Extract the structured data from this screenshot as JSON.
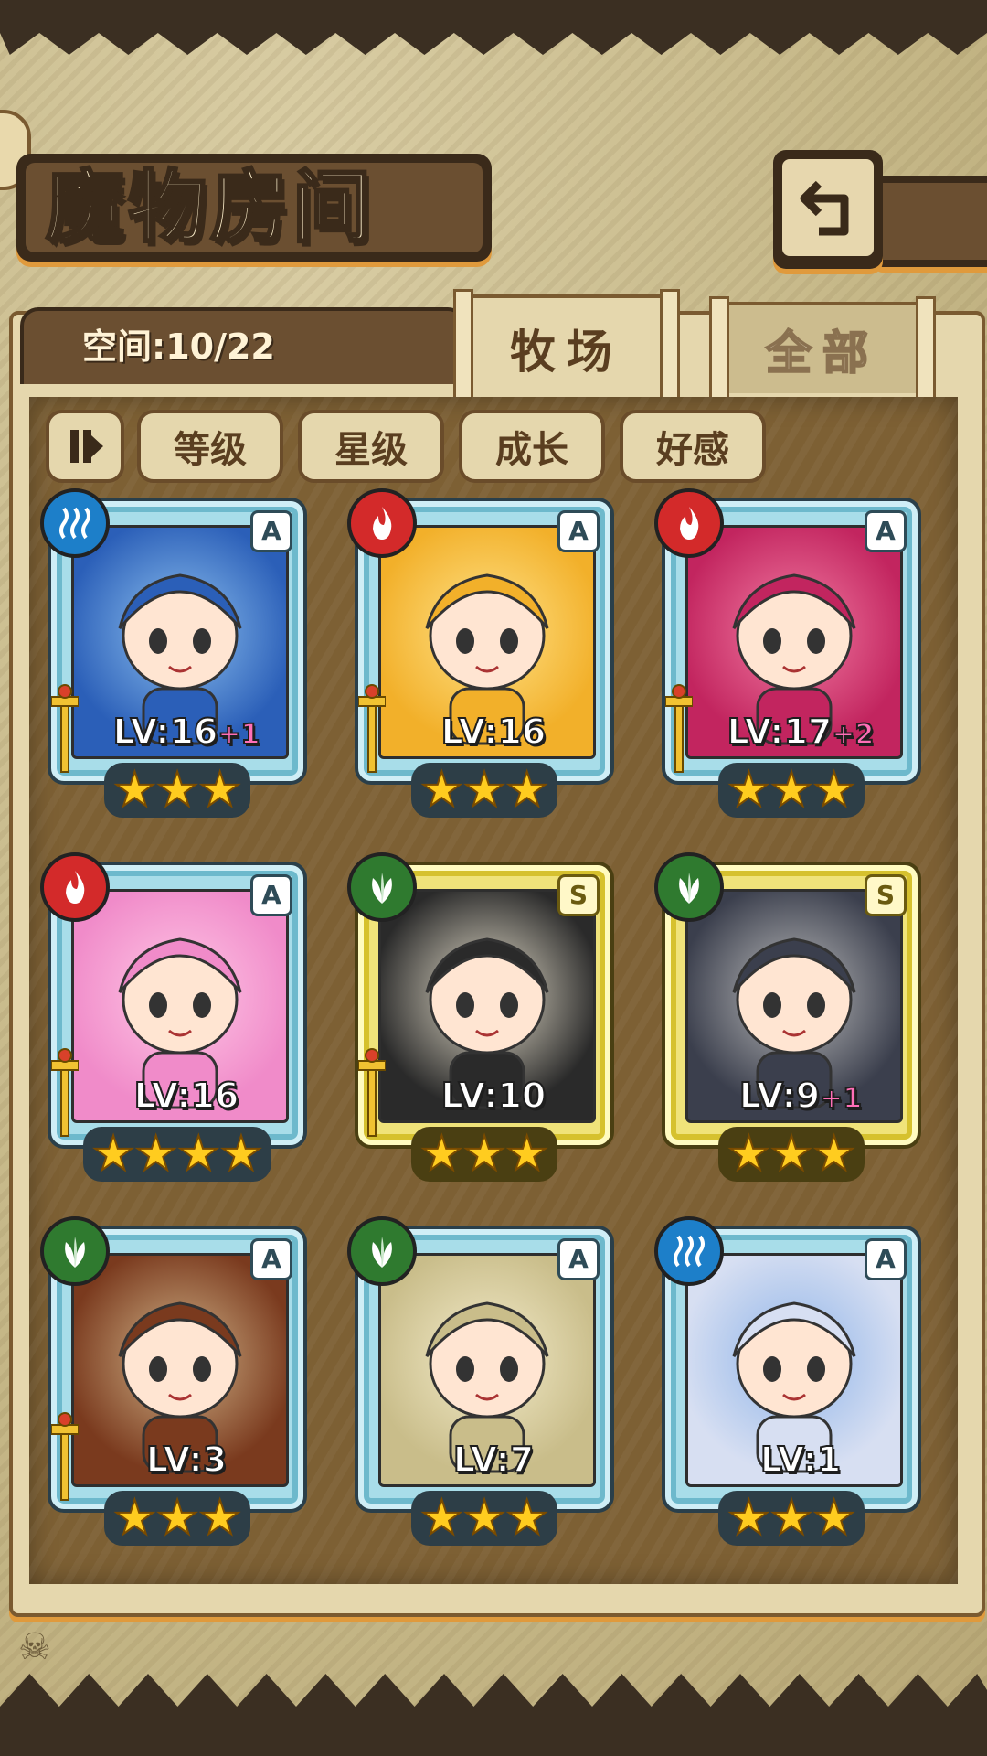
{
  "title": "魔物房间",
  "space": "空间:10/22",
  "tabs": {
    "active": "牧场",
    "inactive": "全部"
  },
  "sort_buttons": [
    "等级",
    "星级",
    "成长",
    "好感"
  ],
  "monsters": [
    {
      "element": "water",
      "rank": "A",
      "level": "LV:16",
      "bonus": "+1",
      "stars": 3,
      "has_weapon": true,
      "colors": [
        "#2b5fb8",
        "#8fc2f0"
      ]
    },
    {
      "element": "fire",
      "rank": "A",
      "level": "LV:16",
      "bonus": "",
      "stars": 3,
      "has_weapon": true,
      "colors": [
        "#f2b02a",
        "#ffe38a"
      ]
    },
    {
      "element": "fire",
      "rank": "A",
      "level": "LV:17",
      "bonus": "+2",
      "stars": 3,
      "has_weapon": true,
      "colors": [
        "#c2255f",
        "#f37da4"
      ]
    },
    {
      "element": "fire",
      "rank": "A",
      "level": "LV:16",
      "bonus": "",
      "stars": 4,
      "has_weapon": true,
      "colors": [
        "#f08bc9",
        "#ffc8e6"
      ]
    },
    {
      "element": "grass",
      "rank": "S",
      "level": "LV:10",
      "bonus": "",
      "stars": 3,
      "has_weapon": true,
      "colors": [
        "#2a2a2a",
        "#e9e2cf"
      ]
    },
    {
      "element": "grass",
      "rank": "S",
      "level": "LV:9",
      "bonus": "+1",
      "stars": 3,
      "has_weapon": false,
      "colors": [
        "#3b3f4d",
        "#bdbdbd"
      ]
    },
    {
      "element": "grass",
      "rank": "A",
      "level": "LV:3",
      "bonus": "",
      "stars": 3,
      "has_weapon": true,
      "colors": [
        "#7a3a1e",
        "#d2b58a"
      ]
    },
    {
      "element": "grass",
      "rank": "A",
      "level": "LV:7",
      "bonus": "",
      "stars": 3,
      "has_weapon": false,
      "colors": [
        "#c9bd8a",
        "#f4eccb"
      ]
    },
    {
      "element": "water",
      "rank": "A",
      "level": "LV:1",
      "bonus": "",
      "stars": 3,
      "has_weapon": false,
      "colors": [
        "#d7dff2",
        "#8fb4e8"
      ]
    }
  ],
  "element_icons": {
    "water": "water-wave-icon",
    "fire": "flame-icon",
    "grass": "leaf-icon"
  }
}
